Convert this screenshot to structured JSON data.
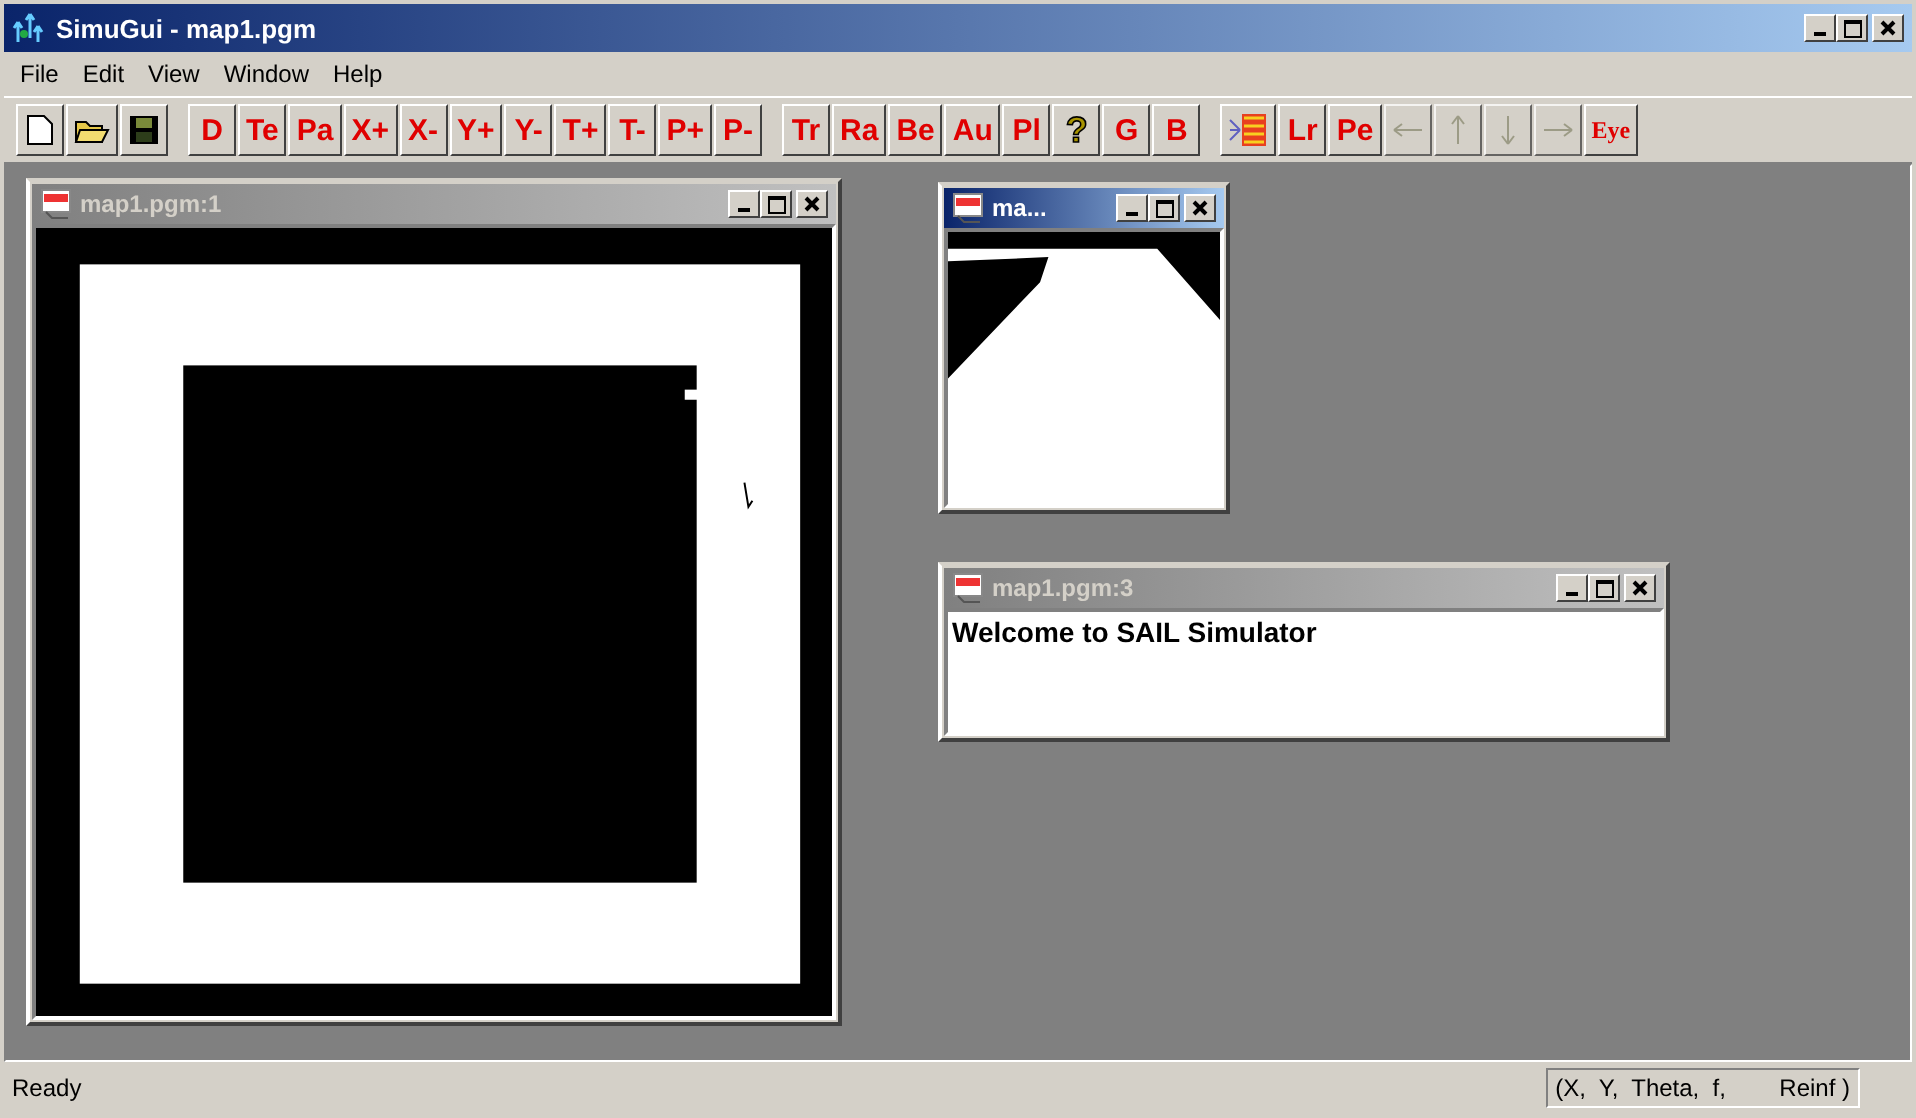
{
  "window": {
    "title": "SimuGui - map1.pgm",
    "active": true
  },
  "menu": [
    "File",
    "Edit",
    "View",
    "Window",
    "Help"
  ],
  "toolbar": [
    [
      {
        "kind": "new"
      },
      {
        "kind": "open"
      },
      {
        "kind": "save"
      }
    ],
    [
      {
        "kind": "text",
        "label": "D"
      },
      {
        "kind": "text",
        "label": "Te"
      },
      {
        "kind": "text",
        "label": "Pa"
      },
      {
        "kind": "text",
        "label": "X+"
      },
      {
        "kind": "text",
        "label": "X-"
      },
      {
        "kind": "text",
        "label": "Y+"
      },
      {
        "kind": "text",
        "label": "Y-"
      },
      {
        "kind": "text",
        "label": "T+"
      },
      {
        "kind": "text",
        "label": "T-"
      },
      {
        "kind": "text",
        "label": "P+"
      },
      {
        "kind": "text",
        "label": "P-"
      }
    ],
    [
      {
        "kind": "text",
        "label": "Tr"
      },
      {
        "kind": "text",
        "label": "Ra"
      },
      {
        "kind": "text",
        "label": "Be"
      },
      {
        "kind": "text",
        "label": "Au"
      },
      {
        "kind": "text",
        "label": "Pl"
      },
      {
        "kind": "help",
        "label": "?"
      },
      {
        "kind": "text",
        "label": "G"
      },
      {
        "kind": "text",
        "label": "B"
      }
    ],
    [
      {
        "kind": "scan"
      },
      {
        "kind": "text",
        "label": "Lr"
      },
      {
        "kind": "text",
        "label": "Pe"
      },
      {
        "kind": "left",
        "disabled": true
      },
      {
        "kind": "up",
        "disabled": true
      },
      {
        "kind": "down",
        "disabled": true
      },
      {
        "kind": "right",
        "disabled": true
      },
      {
        "kind": "serif",
        "label": "Eye"
      }
    ]
  ],
  "documents": [
    {
      "title": "map1.pgm:1",
      "active": false,
      "content": {
        "kind": "map-overview"
      }
    },
    {
      "title": "ma...",
      "active": true,
      "content": {
        "kind": "map-detail"
      }
    },
    {
      "title": "map1.pgm:3",
      "active": false,
      "content": {
        "kind": "text",
        "text": "Welcome to SAIL Simulator"
      }
    }
  ],
  "status_bar": {
    "message": "Ready",
    "fields": "(X,  Y,  Theta,  f,        Reinf )"
  }
}
